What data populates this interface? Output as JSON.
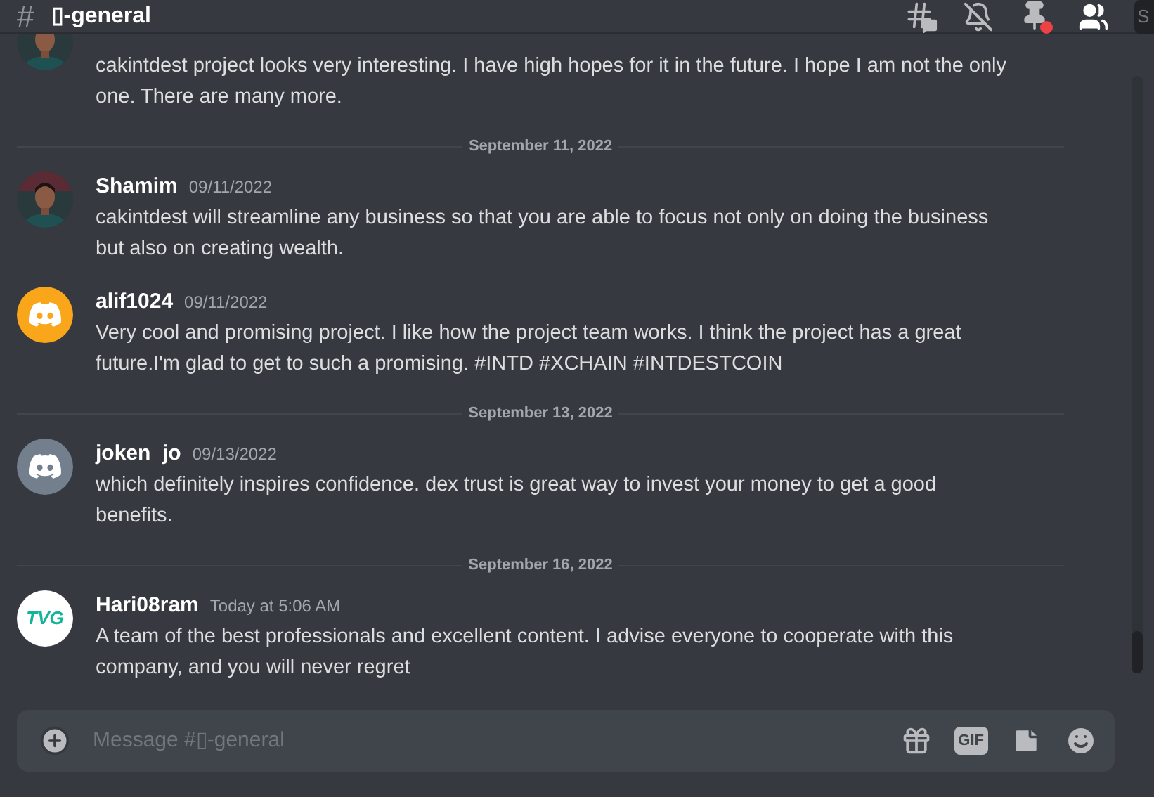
{
  "header": {
    "channel_icon": "#",
    "title": "▯-general",
    "search": "S",
    "alert_pins": true
  },
  "feed": [
    {
      "kind": "continuation",
      "lines": [
        "cakintdest project looks very interesting. I have high hopes for it in the future. I hope I am not the only one. There are many more."
      ]
    },
    {
      "kind": "divider",
      "label": "September 11, 2022"
    },
    {
      "kind": "message",
      "author": "Shamim",
      "time": "09/11/2022",
      "lines": [
        "cakintdest will streamline any business so that you are able to focus not only on doing the business but also on creating wealth."
      ]
    },
    {
      "kind": "message",
      "author": "alif1024",
      "time": "09/11/2022",
      "avatar": {
        "kind": "discord",
        "color": "#faa61a"
      },
      "lines": [
        "Very cool and promising project. I like how the project team works. I think the project has a great future.I'm glad to get to such a promising. #INTD #XCHAIN #INTDESTCOIN"
      ]
    },
    {
      "kind": "divider",
      "label": "September 13, 2022"
    },
    {
      "kind": "message",
      "author": "joken  jo",
      "time": "09/13/2022",
      "avatar": {
        "kind": "discord",
        "color": "#747f8d"
      },
      "lines": [
        "which definitely inspires confidence. dex trust is great way to invest your money to get a good benefits."
      ]
    },
    {
      "kind": "divider",
      "label": "September 16, 2022"
    },
    {
      "kind": "message",
      "author": "Hari08ram",
      "time": "Today at 5:06 AM",
      "avatar": {
        "kind": "logo",
        "text": "TVG"
      },
      "lines": [
        "A team of the best professionals and excellent content. I advise everyone to cooperate with this company, and you will never regret"
      ]
    }
  ],
  "composer": {
    "placeholder": "Message #▯-general",
    "gif_label": "GIF"
  }
}
